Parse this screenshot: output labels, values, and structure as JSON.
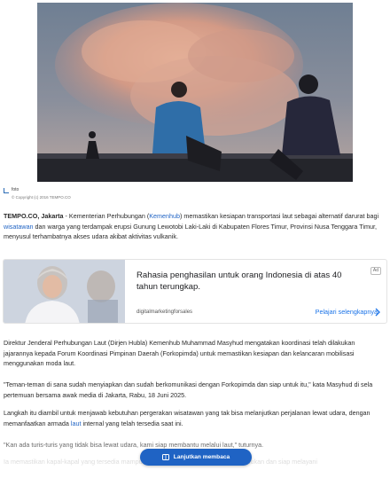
{
  "photo": {
    "caption_label": "foto",
    "copyright": "© Copyright (c) 2016 TEMPO.CO"
  },
  "article": {
    "p1": {
      "source": "TEMPO.CO",
      "city": ", Jakarta",
      "text_a": " - Kementerian Perhubungan (",
      "link_a": "Kemenhub",
      "text_b": ") memastikan kesiapan transportasi laut sebagai alternatif darurat bagi ",
      "link_b": "wisatawan",
      "text_c": " dan warga yang terdampak erupsi Gunung Lewotobi Laki-Laki di Kabupaten Flores Timur, Provinsi Nusa Tenggara Timur, menyusul terhambatnya akses udara akibat aktivitas vulkanik."
    },
    "p2": "Direktur Jenderal Perhubungan Laut (Dirjen Hubla) Kemenhub Muhammad Masyhud mengatakan koordinasi telah dilakukan jajarannya kepada Forum Koordinasi Pimpinan Daerah (Forkopimda) untuk memastikan kesiapan dan kelancaran mobilisasi menggunakan moda laut.",
    "p3": "\"Teman-teman di sana sudah menyiapkan dan sudah berkomunikasi dengan Forkopimda dan siap untuk itu,\" kata Masyhud di sela pertemuan bersama awak media di Jakarta, Rabu, 18 Juni 2025.",
    "p4": {
      "text_a": "Langkah itu diambil untuk menjawab kebutuhan pergerakan wisatawan yang tak bisa melanjutkan perjalanan lewat udara, dengan memanfaatkan armada ",
      "link": "laut",
      "text_b": " internal yang telah tersedia saat ini."
    },
    "p5": "\"Kan ada turis-turis yang tidak bisa lewat udara, kami siap membantu melalui laut,\" tuturnya.",
    "p6": "Ia memastikan kapal-kapal yang tersedia mampu menampung pengungsi apabila diperlukan dan siap melayani"
  },
  "ad": {
    "title": "Rahasia penghasilan untuk orang Indonesia di atas 40 tahun terungkap.",
    "domain": "digitalmarketingforsales",
    "cta": "Pelajari selengkapnya",
    "badge": "Ad",
    "close": "✕"
  },
  "continue_button": {
    "label": "Lanjutkan membaca",
    "icon": "book-icon"
  },
  "colors": {
    "link": "#1f63c4",
    "button": "#1f63c4",
    "ad_cta": "#1a73e8"
  }
}
